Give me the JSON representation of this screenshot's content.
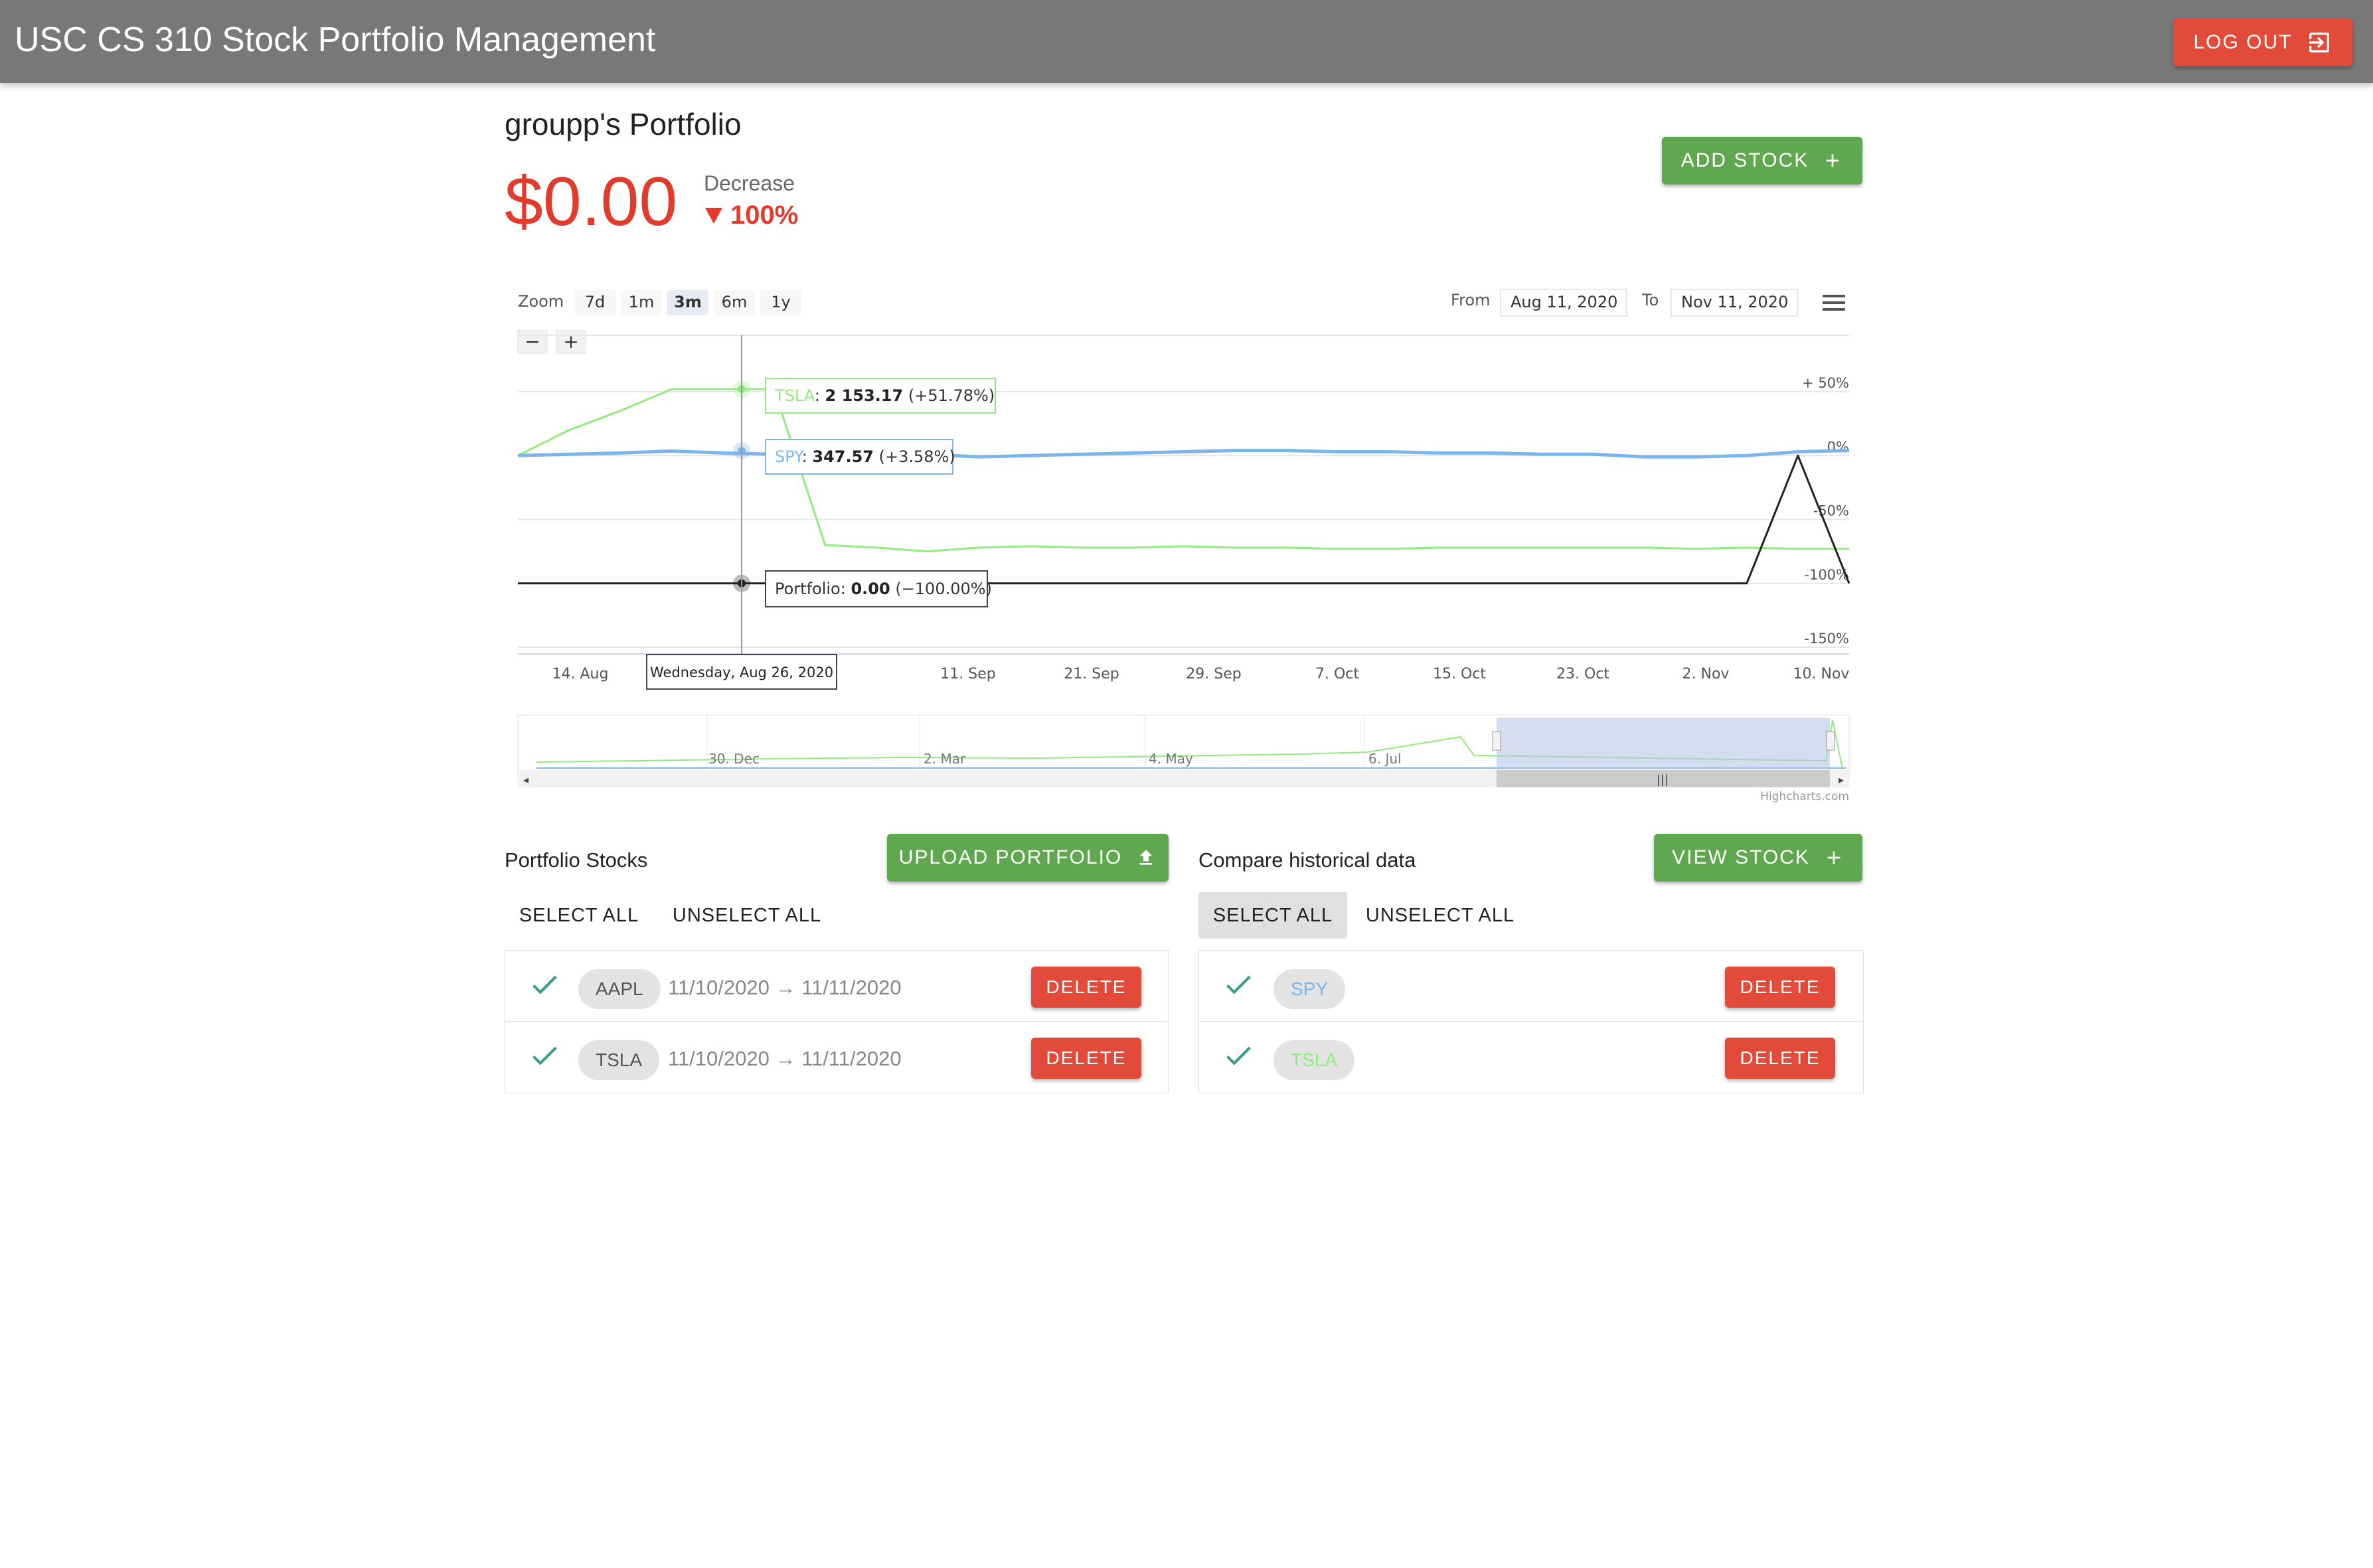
{
  "app": {
    "title": "USC CS 310 Stock Portfolio Management",
    "logout_label": "LOG OUT"
  },
  "portfolio": {
    "title": "groupp's Portfolio",
    "balance": "$0.00",
    "change_label": "Decrease",
    "change_pct": "100%",
    "add_stock_label": "ADD STOCK"
  },
  "chart": {
    "zoom_label": "Zoom",
    "zoom_options": [
      "7d",
      "1m",
      "3m",
      "6m",
      "1y"
    ],
    "zoom_selected": "3m",
    "from_label": "From",
    "from_value": "Aug 11, 2020",
    "to_label": "To",
    "to_value": "Nov 11, 2020",
    "minus_label": "−",
    "plus_label": "+",
    "tooltip_date": "Wednesday, Aug 26, 2020",
    "tooltips": [
      {
        "series": "TSLA",
        "value": "2 153.17",
        "change": "(+51.78%)"
      },
      {
        "series": "SPY",
        "value": "347.57",
        "change": "(+3.58%)"
      },
      {
        "series": "Portfolio",
        "value": "0.00",
        "change": "(−100.00%)"
      }
    ],
    "credits": "Highcharts.com",
    "navigator_labels": [
      "30. Dec",
      "2. Mar",
      "4. May",
      "6. Jul"
    ]
  },
  "chart_data": {
    "type": "line",
    "x_ticks": [
      "14. Aug",
      "11. Sep",
      "21. Sep",
      "29. Sep",
      "7. Oct",
      "15. Oct",
      "23. Oct",
      "2. Nov",
      "10. Nov"
    ],
    "y_ticks": [
      "+ 50%",
      "0%",
      "-50%",
      "-100%",
      "-150%"
    ],
    "ylim": [
      -150,
      50
    ],
    "series": [
      {
        "name": "TSLA",
        "color": "#90ed7d",
        "values": [
          0,
          20,
          35,
          52,
          52,
          52,
          -70,
          -72,
          -75,
          -72,
          -71,
          -72,
          -72,
          -71,
          -72,
          -72,
          -73,
          -73,
          -72,
          -72,
          -72,
          -72,
          -72,
          -73,
          -72,
          -73,
          -73
        ]
      },
      {
        "name": "SPY",
        "color": "#7cb5ec",
        "values": [
          0,
          1,
          2,
          3.58,
          2,
          1,
          2,
          3,
          1,
          -1,
          0,
          1,
          2,
          3,
          4,
          4,
          3,
          3,
          2,
          2,
          1,
          1,
          -1,
          -1,
          0,
          3,
          4
        ]
      },
      {
        "name": "Portfolio",
        "color": "#222222",
        "values": [
          -100,
          -100,
          -100,
          -100,
          -100,
          -100,
          -100,
          -100,
          -100,
          -100,
          -100,
          -100,
          -100,
          -100,
          -100,
          -100,
          -100,
          -100,
          -100,
          -100,
          -100,
          -100,
          -100,
          -100,
          -100,
          0,
          -100
        ]
      }
    ]
  },
  "portfolio_stocks": {
    "label": "Portfolio Stocks",
    "upload_label": "UPLOAD PORTFOLIO",
    "select_all": "SELECT ALL",
    "unselect_all": "UNSELECT ALL",
    "items": [
      {
        "ticker": "AAPL",
        "dates": "11/10/2020 → 11/11/2020",
        "delete_label": "DELETE"
      },
      {
        "ticker": "TSLA",
        "dates": "11/10/2020 → 11/11/2020",
        "delete_label": "DELETE"
      }
    ]
  },
  "compare": {
    "label": "Compare historical data",
    "view_stock_label": "VIEW STOCK",
    "select_all": "SELECT ALL",
    "unselect_all": "UNSELECT ALL",
    "items": [
      {
        "ticker": "SPY",
        "color": "#7cb5ec",
        "delete_label": "DELETE"
      },
      {
        "ticker": "TSLA",
        "color": "#90ed7d",
        "delete_label": "DELETE"
      }
    ]
  },
  "colors": {
    "appbar": "#787878",
    "danger": "#e24b39",
    "success": "#60a84f",
    "negative_text": "#e33b2b"
  }
}
